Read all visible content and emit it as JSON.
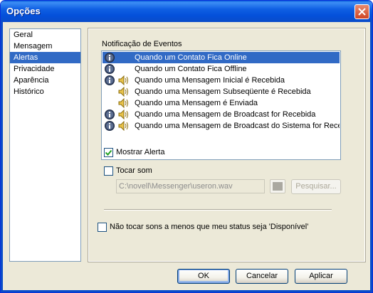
{
  "window": {
    "title": "Opções"
  },
  "sidebar": {
    "items": [
      {
        "label": "Geral",
        "selected": false
      },
      {
        "label": "Mensagem",
        "selected": false
      },
      {
        "label": "Alertas",
        "selected": true
      },
      {
        "label": "Privacidade",
        "selected": false
      },
      {
        "label": "Aparência",
        "selected": false
      },
      {
        "label": "Histórico",
        "selected": false
      }
    ]
  },
  "alerts": {
    "section_title": "Notificação de Eventos",
    "events": [
      {
        "label": "Quando um Contato Fica Online",
        "info_icon": true,
        "sound_icon": false,
        "selected": true
      },
      {
        "label": "Quando um Contato Fica Offline",
        "info_icon": true,
        "sound_icon": false,
        "selected": false
      },
      {
        "label": "Quando uma Mensagem Inicial é Recebida",
        "info_icon": true,
        "sound_icon": true,
        "selected": false
      },
      {
        "label": "Quando uma Mensagem Subseqüente é Recebida",
        "info_icon": false,
        "sound_icon": true,
        "selected": false
      },
      {
        "label": "Quando uma Mensagem é Enviada",
        "info_icon": false,
        "sound_icon": true,
        "selected": false
      },
      {
        "label": "Quando uma Mensagem de Broadcast for Recebida",
        "info_icon": true,
        "sound_icon": true,
        "selected": false
      },
      {
        "label": "Quando uma Mensagem de Broadcast do Sistema for Recebi",
        "info_icon": true,
        "sound_icon": true,
        "selected": false
      }
    ],
    "show_alert": {
      "label": "Mostrar Alerta",
      "checked": true
    },
    "play_sound": {
      "label": "Tocar som",
      "checked": false
    },
    "sound_path": "C:\\novell\\Messenger\\useron.wav",
    "browse_label": "Pesquisar...",
    "only_available": {
      "label": "Não tocar sons a menos que meu status seja 'Disponível'",
      "checked": false
    }
  },
  "footer": {
    "ok": "OK",
    "cancel": "Cancelar",
    "apply": "Aplicar"
  },
  "colors": {
    "selection": "#316ac5",
    "titlebar": "#0a5fdc",
    "dialog_bg": "#ece9d8"
  }
}
